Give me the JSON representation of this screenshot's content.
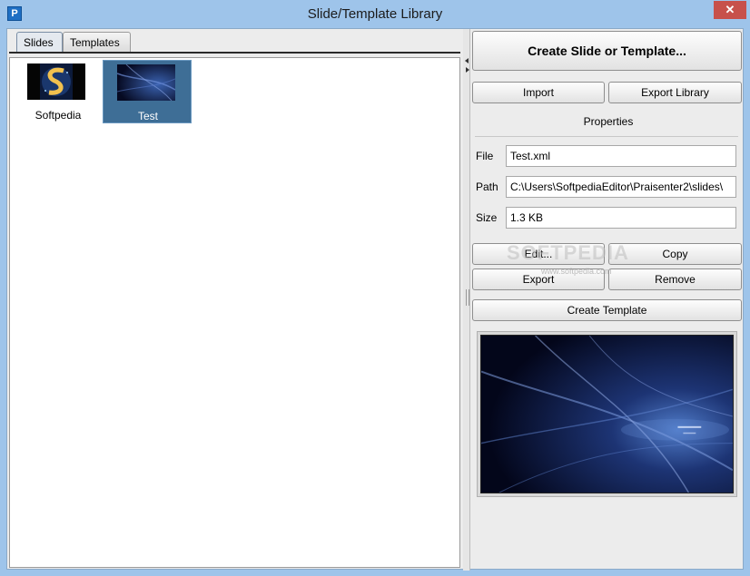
{
  "window": {
    "title": "Slide/Template Library",
    "app_icon_letter": "P",
    "close_glyph": "✕"
  },
  "tabs": [
    {
      "label": "Slides",
      "active": true
    },
    {
      "label": "Templates",
      "active": false
    }
  ],
  "slides": [
    {
      "label": "Softpedia",
      "selected": false
    },
    {
      "label": "Test",
      "selected": true
    }
  ],
  "actions": {
    "create_label": "Create Slide or Template...",
    "import_label": "Import",
    "export_library_label": "Export Library",
    "edit_label": "Edit...",
    "copy_label": "Copy",
    "export_label": "Export",
    "remove_label": "Remove",
    "create_template_label": "Create Template"
  },
  "properties": {
    "title": "Properties",
    "file_label": "File",
    "file_value": "Test.xml",
    "path_label": "Path",
    "path_value": "C:\\Users\\SoftpediaEditor\\Praisenter2\\slides\\",
    "size_label": "Size",
    "size_value": "1.3 KB"
  },
  "watermark": {
    "text": "SOFTPEDIA",
    "subtext": "www.softpedia.com"
  },
  "colors": {
    "selection": "#3e6e96",
    "title_bar": "#9ec4ea",
    "close_button": "#c7514b"
  }
}
